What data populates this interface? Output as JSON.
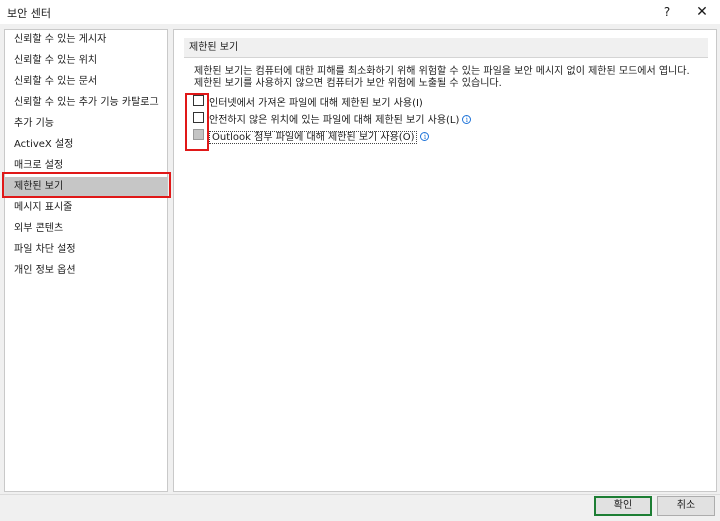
{
  "window": {
    "title": "보안 센터",
    "help_label": "?",
    "close_label": "✕"
  },
  "sidebar": {
    "items": [
      {
        "label": "신뢰할 수 있는 게시자"
      },
      {
        "label": "신뢰할 수 있는 위치"
      },
      {
        "label": "신뢰할 수 있는 문서"
      },
      {
        "label": "신뢰할 수 있는 추가 기능 카탈로그"
      },
      {
        "label": "추가 기능"
      },
      {
        "label": "ActiveX 설정"
      },
      {
        "label": "매크로 설정"
      },
      {
        "label": "제한된 보기"
      },
      {
        "label": "메시지 표시줄"
      },
      {
        "label": "외부 콘텐츠"
      },
      {
        "label": "파일 차단 설정"
      },
      {
        "label": "개인 정보 옵션"
      }
    ],
    "selected": "제한된 보기"
  },
  "content": {
    "section_title": "제한된 보기",
    "description_line1": "제한된 보기는 컴퓨터에 대한 피해를 최소화하기 위해 위험할 수 있는 파일을 보안 메시지 없이 제한된 모드에서 엽니다.",
    "description_line2": "제한된 보기를 사용하지 않으면 컴퓨터가 보안 위험에 노출될 수 있습니다.",
    "options": [
      {
        "label": "인터넷에서 가져온 파일에 대해 제한된 보기 사용(I)",
        "checked": false,
        "enabled": true
      },
      {
        "label": "안전하지 않은 위치에 있는 파일에 대해 제한된 보기 사용(L)",
        "checked": false,
        "enabled": true
      },
      {
        "label": "Outlook 첨부 파일에 대해 제한된 보기 사용(O)",
        "checked": false,
        "enabled": false
      }
    ],
    "info_glyph": "i"
  },
  "footer": {
    "ok_label": "확인",
    "cancel_label": "취소"
  },
  "colors": {
    "highlight_outline": "#e01818",
    "default_button_border": "#1d7e34",
    "info_icon": "#1e73d8"
  }
}
